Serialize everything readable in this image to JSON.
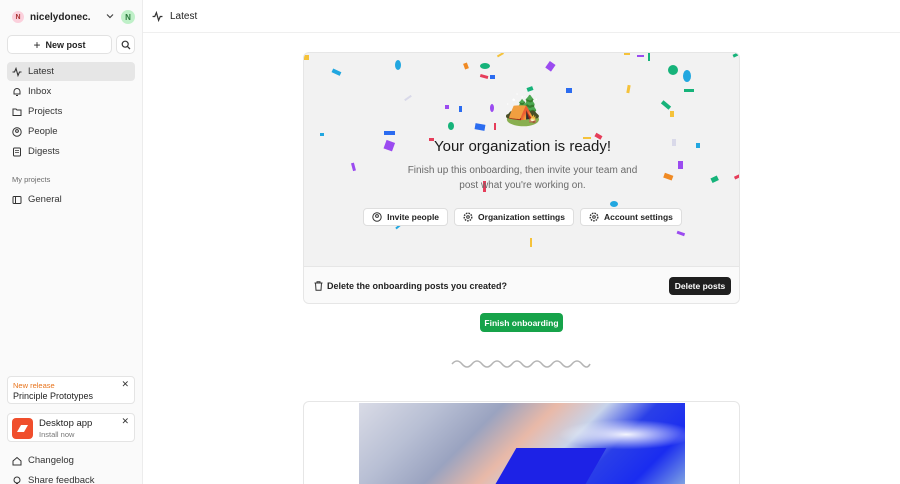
{
  "workspace": {
    "avatar_letter": "N",
    "name": "nicelydonec...",
    "user_letter": "N"
  },
  "sidebar": {
    "new_post_label": "New post",
    "nav": [
      {
        "label": "Latest"
      },
      {
        "label": "Inbox"
      },
      {
        "label": "Projects"
      },
      {
        "label": "People"
      },
      {
        "label": "Digests"
      }
    ],
    "section_label": "My projects",
    "projects": [
      {
        "label": "General"
      }
    ],
    "release_card": {
      "tag": "New release",
      "name": "Principle Prototypes"
    },
    "desktop_card": {
      "title": "Desktop app",
      "subtitle": "Install now"
    },
    "footer": [
      {
        "label": "Changelog"
      },
      {
        "label": "Share feedback"
      }
    ]
  },
  "header": {
    "title": "Latest"
  },
  "onboarding": {
    "title": "Your organization is ready!",
    "subtitle": "Finish up this onboarding, then invite your team and post what you're working on.",
    "actions": [
      {
        "label": "Invite people"
      },
      {
        "label": "Organization settings"
      },
      {
        "label": "Account settings"
      }
    ],
    "delete_prompt": "Delete the onboarding posts you created?",
    "delete_button": "Delete posts",
    "finish_button": "Finish onboarding"
  },
  "colors": {
    "accent_green": "#16a34a",
    "dark_button": "#1f1f1f",
    "release_orange": "#e8741c",
    "app_icon": "#f04e2c"
  }
}
